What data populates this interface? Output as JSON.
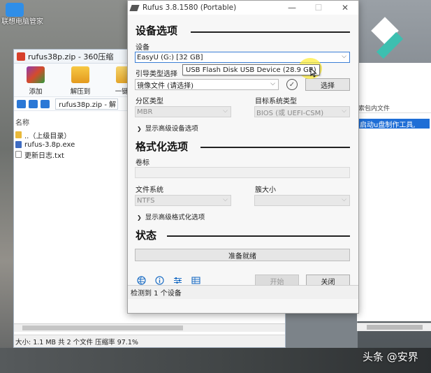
{
  "desktop": {
    "icon_label": "联想电脑管家"
  },
  "zip_window": {
    "title": "rufus38p.zip - 360压缩",
    "toolbar": [
      "添加",
      "解压到",
      "一键解"
    ],
    "path": "rufus38p.zip - 解",
    "column_header": "名称",
    "files": [
      "..（上级目录）",
      "rufus-3.8p.exe",
      "更新日志.txt"
    ],
    "status": "大小: 1.1 MB 共 2 个文件 压缩率 97.1%"
  },
  "right_panel": {
    "search_text": "索包内文件",
    "highlight_text": "启动u盘制作工具,"
  },
  "rufus": {
    "title": "Rufus 3.8.1580 (Portable)",
    "window_controls": [
      "—",
      "☐",
      "✕"
    ],
    "drive_section_title": "设备选项",
    "device_label": "设备",
    "device_value": "EasyU (G:) [32 GB]",
    "device_tooltip": "USB Flash Disk USB Device (28.9 GB)",
    "boot_label": "引导类型选择",
    "boot_value": "镜像文件 (请选择)",
    "select_button": "选择",
    "partition_label": "分区类型",
    "partition_value": "MBR",
    "target_label": "目标系统类型",
    "target_value": "BIOS (或 UEFI-CSM)",
    "advanced_drive": "显示高级设备选项",
    "format_section_title": "格式化选项",
    "volume_label": "卷标",
    "volume_value": "",
    "fs_label": "文件系统",
    "fs_value": "NTFS",
    "cluster_label": "簇大小",
    "cluster_value": "",
    "advanced_format": "显示高级格式化选项",
    "status_section_title": "状态",
    "progress_text": "准备就绪",
    "progress_fraction": 0,
    "start_button": "开始",
    "close_button": "关闭",
    "status_bar": "检测到 1 个设备"
  },
  "watermark": "头条 @安界",
  "colors": {
    "accent": "#3c7fd6",
    "highlight": "#ffee3c",
    "logo_teal": "#3dbfb0"
  }
}
